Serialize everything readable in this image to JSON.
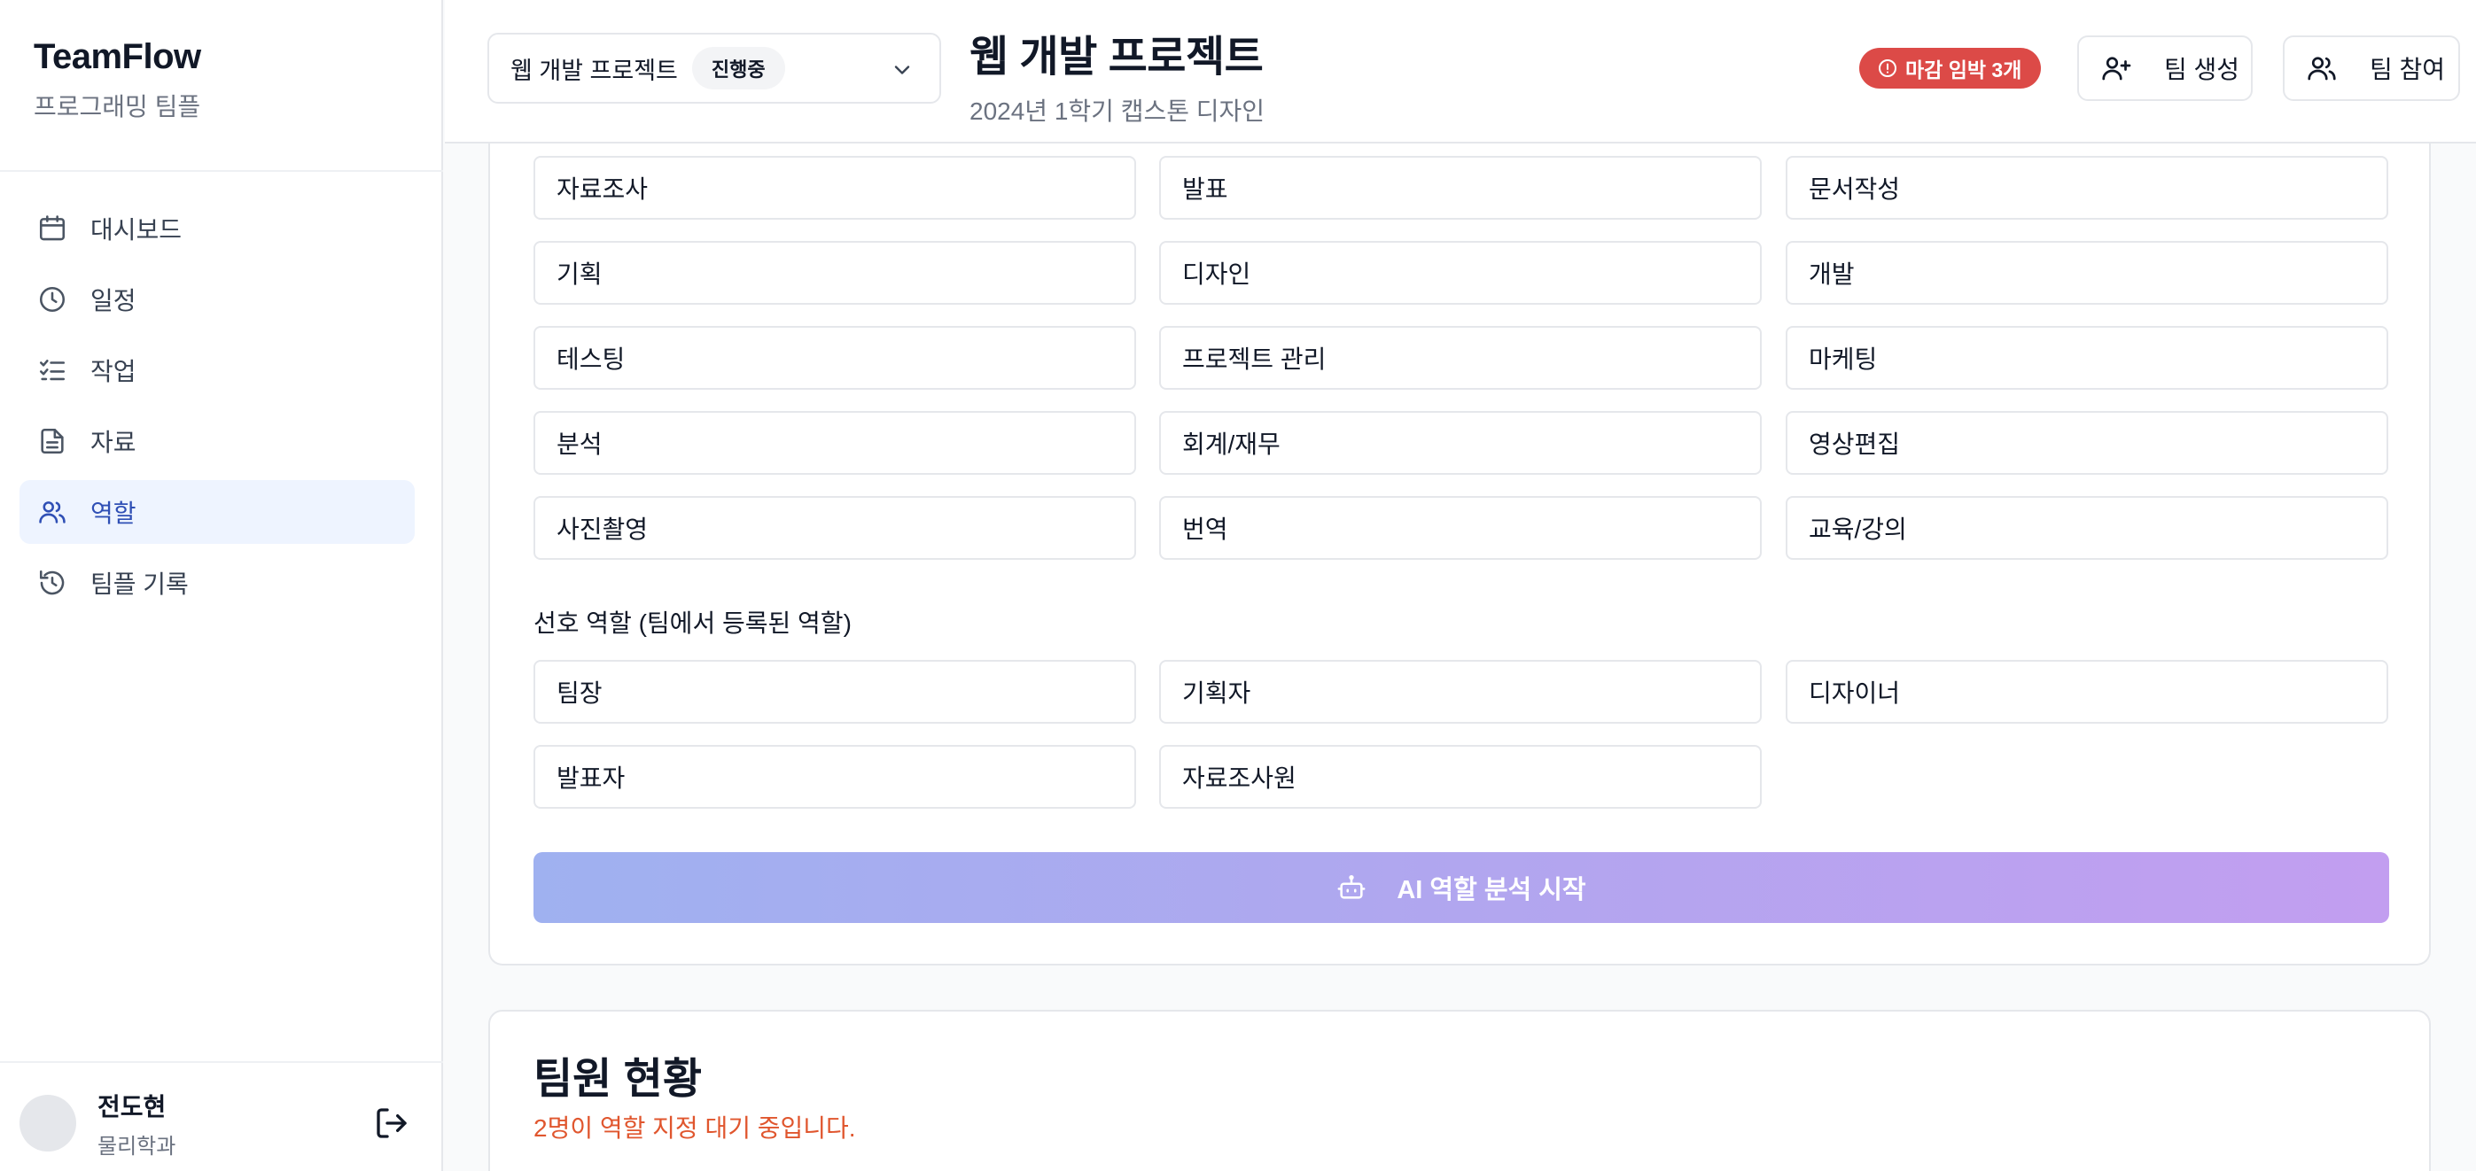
{
  "sidebar": {
    "brand_name": "TeamFlow",
    "brand_sub": "프로그래밍 팀플",
    "items": [
      {
        "label": "대시보드",
        "icon": "calendar-icon"
      },
      {
        "label": "일정",
        "icon": "clock-icon"
      },
      {
        "label": "작업",
        "icon": "checklist-icon"
      },
      {
        "label": "자료",
        "icon": "document-icon"
      },
      {
        "label": "역할",
        "icon": "users-icon",
        "active": true
      },
      {
        "label": "팀플 기록",
        "icon": "history-icon"
      }
    ],
    "user": {
      "name": "전도현",
      "dept": "물리학과"
    }
  },
  "header": {
    "project_select": {
      "name": "웹 개발 프로젝트",
      "status": "진행중"
    },
    "title": "웹 개발 프로젝트",
    "subtitle": "2024년 1학기 캡스톤 디자인",
    "deadline_badge": "마감 임박 3개",
    "create_team": "팀 생성",
    "join_team": "팀 참여"
  },
  "skills": [
    "자료조사",
    "발표",
    "문서작성",
    "기획",
    "디자인",
    "개발",
    "테스팅",
    "프로젝트 관리",
    "마케팅",
    "분석",
    "회계/재무",
    "영상편집",
    "사진촬영",
    "번역",
    "교육/강의"
  ],
  "preferred_roles": {
    "label": "선호 역할 (팀에서 등록된 역할)",
    "options": [
      "팀장",
      "기획자",
      "디자이너",
      "발표자",
      "자료조사원"
    ]
  },
  "ai_button": "AI 역할 분석 시작",
  "members": {
    "title": "팀원 현황",
    "subtitle": "2명이 역할 지정 대기 중입니다."
  },
  "colors": {
    "accent": "#2f4fb5",
    "active_bg": "#eef4ff",
    "badge_red": "#dc4a47",
    "warning_text": "#e0562e"
  }
}
